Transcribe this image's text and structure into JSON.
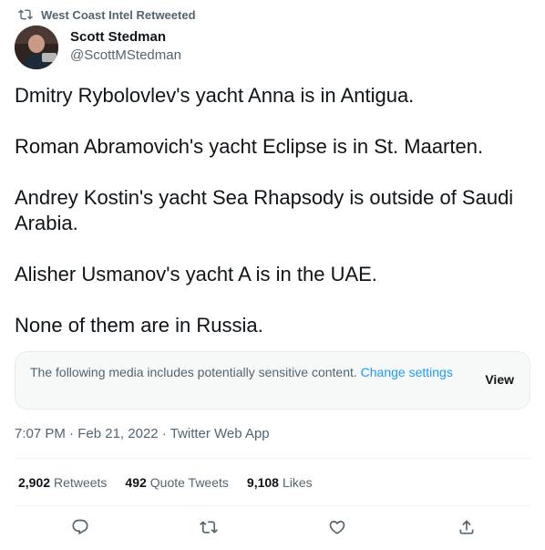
{
  "retweet_banner": {
    "icon": "retweet-icon",
    "text": "West Coast Intel Retweeted"
  },
  "author": {
    "display_name": "Scott Stedman",
    "handle": "@ScottMStedman",
    "avatar_icon": "avatar-photo"
  },
  "tweet": {
    "paragraphs": [
      "Dmitry Rybolovlev's yacht Anna is in Antigua.",
      "Roman Abramovich's yacht Eclipse is in St. Maarten.",
      "Andrey Kostin's yacht Sea Rhapsody is outside of Saudi Arabia.",
      "Alisher Usmanov's yacht A is in the UAE.",
      "None of them are in Russia."
    ]
  },
  "sensitive": {
    "notice": "The following media includes potentially sensitive content.",
    "link": "Change settings",
    "view_label": "View"
  },
  "meta": {
    "time": "7:07 PM",
    "date": "Feb 21, 2022",
    "client": "Twitter Web App",
    "separator": "·"
  },
  "stats": {
    "retweets": {
      "count": "2,902",
      "label": "Retweets"
    },
    "quote_tweets": {
      "count": "492",
      "label": "Quote Tweets"
    },
    "likes": {
      "count": "9,108",
      "label": "Likes"
    }
  },
  "actions": [
    "reply-icon",
    "retweet-icon",
    "like-icon",
    "share-icon"
  ],
  "colors": {
    "link": "#1d9bf0",
    "secondary_text": "#536471",
    "primary_text": "#0f1419"
  }
}
